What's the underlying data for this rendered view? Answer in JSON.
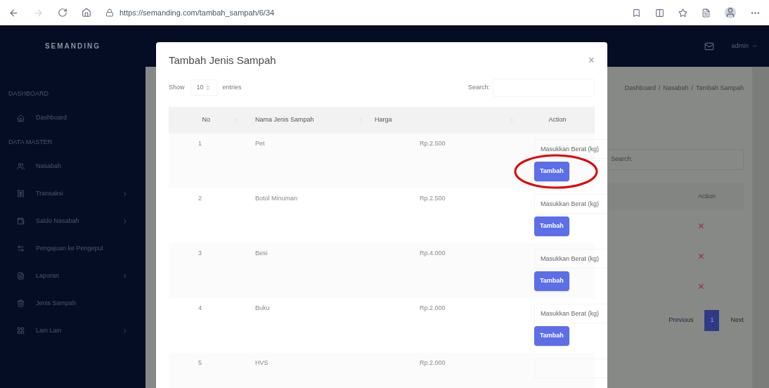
{
  "browser": {
    "url": "https://semanding.com/tambah_sampah/6/34"
  },
  "app": {
    "brand": "SEMANDING",
    "user": "admin"
  },
  "sidebar": {
    "sections": [
      {
        "heading": "DASHBOARD",
        "items": [
          {
            "label": "Dashboard",
            "submenu": false
          }
        ]
      },
      {
        "heading": "DATA MASTER",
        "items": [
          {
            "label": "Nasabah",
            "submenu": false
          },
          {
            "label": "Transaksi",
            "submenu": true
          },
          {
            "label": "Saldo Nasabah",
            "submenu": true
          },
          {
            "label": "Pengajuan ke Pengepul",
            "submenu": false
          },
          {
            "label": "Laporan",
            "submenu": true
          },
          {
            "label": "Jenis Sampah",
            "submenu": false
          },
          {
            "label": "Lain Lain",
            "submenu": true
          }
        ]
      }
    ]
  },
  "background_page": {
    "breadcrumb": [
      "Dashboard",
      "Nasabah",
      "Tambah Sampah"
    ],
    "breadcrumb_separator": "/",
    "search_label": "Search:",
    "action_header": "Action",
    "pagination": {
      "previous": "Previous",
      "page": "1",
      "next": "Next"
    }
  },
  "modal": {
    "title": "Tambah Jenis Sampah",
    "close": "×",
    "show_label": "Show",
    "entries_value": "10",
    "entries_label": "entries",
    "search_label": "Search:",
    "columns": [
      "No",
      "Nama Jenis Sampah",
      "Harga",
      "Action"
    ],
    "rows": [
      {
        "no": "1",
        "name": "Pet",
        "price": "Rp.2.500",
        "placeholder": "Masukkan Berat (kg)",
        "button": "Tambah",
        "highlighted": true
      },
      {
        "no": "2",
        "name": "Botol Minuman",
        "price": "Rp.2.500",
        "placeholder": "Masukkan Berat (kg)",
        "button": "Tambah",
        "highlighted": false
      },
      {
        "no": "3",
        "name": "Besi",
        "price": "Rp.4.000",
        "placeholder": "Masukkan Berat (kg)",
        "button": "Tambah",
        "highlighted": false
      },
      {
        "no": "4",
        "name": "Buku",
        "price": "Rp.2.000",
        "placeholder": "Masukkan Berat (kg)",
        "button": "Tambah",
        "highlighted": false
      },
      {
        "no": "5",
        "name": "HVS",
        "price": "Rp.2.000",
        "highlighted": false
      }
    ]
  }
}
